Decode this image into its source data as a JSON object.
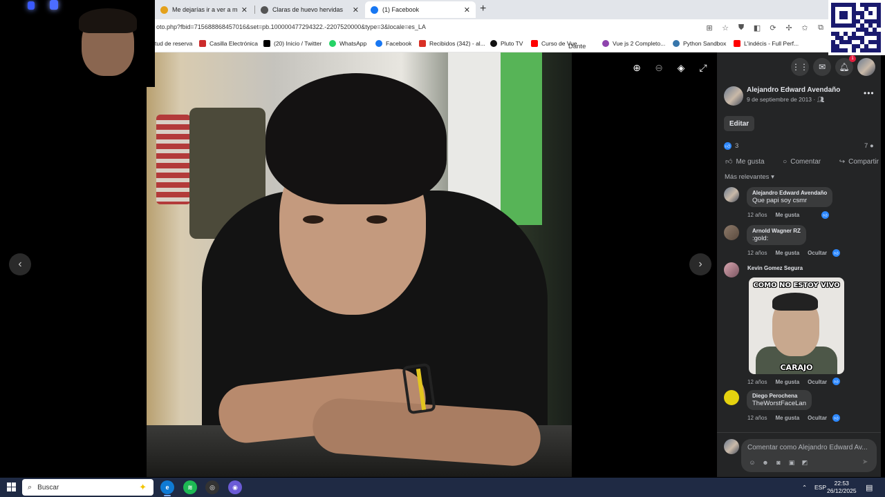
{
  "browser": {
    "tabs": [
      {
        "label": "Me dejarías ir a ver a mi esposa en",
        "color": "#e4a11b"
      },
      {
        "label": "Claras de huevo hervidas",
        "color": "#555555"
      },
      {
        "label": "(1) Facebook",
        "color": "#1877f2"
      }
    ],
    "new_tab": "+",
    "url": "oto.php?fbid=715688868457016&set=pb.100000477294322.-2207520000&type=3&locale=es_LA",
    "bookmarks": [
      {
        "label": "tud de reserva",
        "color": "#cccccc"
      },
      {
        "label": "Casilla Electrónica",
        "color": "#cc2b2b"
      },
      {
        "label": "(20) Inicio / Twitter",
        "color": "#000000"
      },
      {
        "label": "WhatsApp",
        "color": "#25d366"
      },
      {
        "label": "Facebook",
        "color": "#1877f2"
      },
      {
        "label": "Recibidos (342) - al...",
        "color": "#d93025"
      },
      {
        "label": "Pluto TV",
        "color": "#111111"
      },
      {
        "label": "Curso de Vue",
        "color": "#ff0000"
      },
      {
        "label": "Vue js 2 Completo...",
        "color": "#8e44ad"
      },
      {
        "label": "Python Sandbox",
        "color": "#3776ab"
      },
      {
        "label": "L'indécis - Full Perf...",
        "color": "#ff0000"
      }
    ],
    "overlay_text": "Dante"
  },
  "post": {
    "author": "Alejandro Edward Avendaño",
    "date": "9 de septiembre de 2013 ·",
    "edit_label": "Editar",
    "likes": "3",
    "comments_count": "7",
    "actions": {
      "like": "Me gusta",
      "comment": "Comentar",
      "share": "Compartir"
    },
    "sort_label": "Más relevantes",
    "comments": [
      {
        "name": "Alejandro Edward Avendaño",
        "text": "Que papi soy csmr",
        "age": "12 años",
        "like": "Me gusta",
        "hide": ""
      },
      {
        "name": "Arnold Wagner RZ",
        "text": ":gold:",
        "age": "12 años",
        "like": "Me gusta",
        "hide": "Ocultar"
      },
      {
        "name": "Kevin Gomez Segura",
        "text": "",
        "age": "12 años",
        "like": "Me gusta",
        "hide": "Ocultar"
      },
      {
        "name": "Diego Perochena",
        "text": "TheWorstFaceLan",
        "age": "12 años",
        "like": "Me gusta",
        "hide": "Ocultar"
      }
    ],
    "meme": {
      "top": "COMO NO ESTOY VIVO",
      "bottom": "CARAJO"
    },
    "composer_placeholder": "Comentar como Alejandro Edward Av...",
    "notifications_badge": "1"
  },
  "taskbar": {
    "search_label": "Buscar",
    "language": "ESP",
    "time": "22:53",
    "date": "26/12/2025"
  }
}
